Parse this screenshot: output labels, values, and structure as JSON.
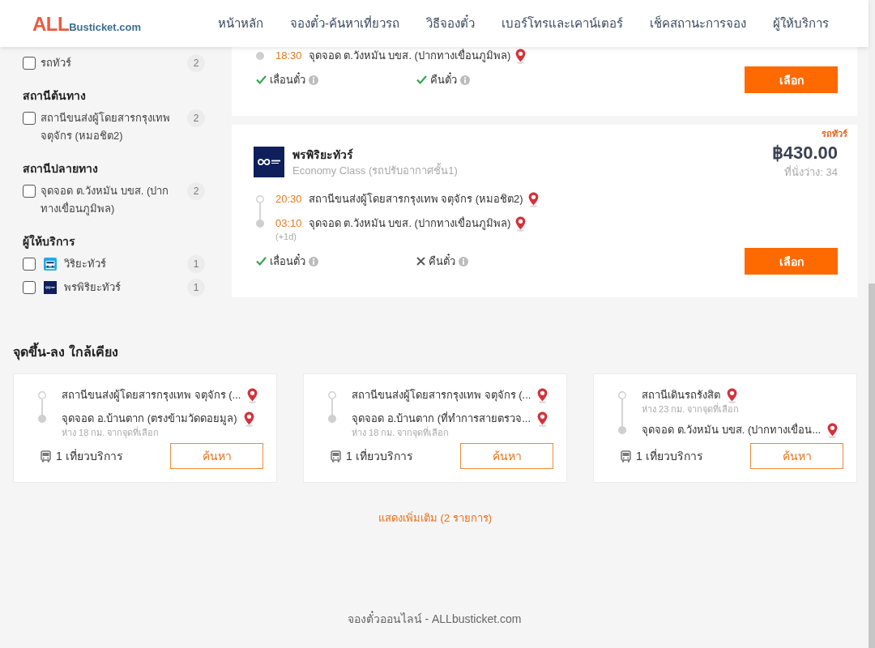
{
  "header": {
    "logo": {
      "accent": "ALL",
      "name": "Busticket.com"
    },
    "nav": [
      "หน้าหลัก",
      "จองตั๋ว-ค้นหาเที่ยวรถ",
      "วิธีจองตั๋ว",
      "เบอร์โทรและเคาน์เตอร์",
      "เช็คสถานะการจอง",
      "ผู้ให้บริการ"
    ]
  },
  "sidebar": {
    "sections": [
      {
        "options": [
          {
            "kind": "plain",
            "label": "รถทัวร์",
            "count": "2",
            "checked": false
          }
        ]
      },
      {
        "heading": "สถานีต้นทาง",
        "options": [
          {
            "kind": "plain",
            "label": "สถานีขนส่งผู้โดยสารกรุงเทพ จตุจักร (หมอชิต2)",
            "count": "2",
            "checked": false
          }
        ]
      },
      {
        "heading": "สถานีปลายทาง",
        "options": [
          {
            "kind": "plain",
            "label": "จุดจอด ต.วังหมัน บขส. (ปากทางเขื่อนภูมิพล)",
            "count": "2",
            "checked": false
          }
        ]
      },
      {
        "heading": "ผู้ให้บริการ",
        "options": [
          {
            "kind": "logo",
            "label": "วิริยะทัวร์",
            "count": "1",
            "checked": false,
            "color": "#27a9e1"
          },
          {
            "kind": "logo",
            "label": "พรพิริยะทัวร์",
            "count": "1",
            "checked": false,
            "color": "#0e1f5b"
          }
        ]
      }
    ]
  },
  "trips": [
    {
      "stops": [
        {
          "kind": "arrival",
          "time": "18:30",
          "place": "จุดจอด ต.วังหมัน บขส. (ปากทางเขื่อนภูมิพล)"
        }
      ],
      "policies": [
        {
          "label": "เลื่อนตั๋ว",
          "allowed": true
        },
        {
          "label": "คืนตั๋ว",
          "allowed": true
        }
      ],
      "button": "เลือก"
    },
    {
      "tag": "รถทัวร์",
      "operator": "พรพิริยะทัวร์",
      "color": "#0e1f5b",
      "bus_class": "Economy Class (รถปรับอากาศชั้น1)",
      "price": "฿430.00",
      "seats": "ที่นั่งว่าง: 34",
      "stops": [
        {
          "kind": "departure",
          "time": "20:30",
          "place": "สถานีขนส่งผู้โดยสารกรุงเทพ จตุจักร (หมอชิต2)"
        },
        {
          "kind": "arrival",
          "time": "03:10",
          "place": "จุดจอด ต.วังหมัน บขส. (ปากทางเขื่อนภูมิพล)",
          "day_offset": "(+1d)"
        }
      ],
      "policies": [
        {
          "label": "เลื่อนตั๋ว",
          "allowed": true
        },
        {
          "label": "คืนตั๋ว",
          "allowed": false
        }
      ],
      "button": "เลือก"
    }
  ],
  "nearby": {
    "heading": "จุดขึ้น-ลง ใกล้เคียง",
    "cards": [
      {
        "stops": [
          {
            "kind": "departure",
            "place": "สถานีขนส่งผู้โดยสารกรุงเทพ จตุจักร (..."
          },
          {
            "kind": "arrival",
            "place": "จุดจอด อ.บ้านตาก (ตรงข้ามวัดดอยมูล)",
            "note": "ห่าง 18 กม. จากจุดที่เลือก"
          }
        ],
        "trips": "1 เที่ยวบริการ",
        "button": "ค้นหา"
      },
      {
        "stops": [
          {
            "kind": "departure",
            "place": "สถานีขนส่งผู้โดยสารกรุงเทพ จตุจักร (..."
          },
          {
            "kind": "arrival",
            "place": "จุดจอด อ.บ้านตาก (ที่ทำการสายตรวจ...",
            "note": "ห่าง 18 กม. จากจุดที่เลือก"
          }
        ],
        "trips": "1 เที่ยวบริการ",
        "button": "ค้นหา"
      },
      {
        "stops": [
          {
            "kind": "departure",
            "place": "สถานีเดินรถรังสิต",
            "note": "ห่าง 23 กม. จากจุดที่เลือก"
          },
          {
            "kind": "arrival",
            "place": "จุดจอด ต.วังหมัน บขส. (ปากทางเขื่อน..."
          }
        ],
        "trips": "1 เที่ยวบริการ",
        "button": "ค้นหา"
      }
    ],
    "more": "แสดงเพิ่มเติม (2 รายการ)"
  },
  "footer": {
    "text": "จองตั๋วออนไลน์ - ALLbusticket.com"
  }
}
